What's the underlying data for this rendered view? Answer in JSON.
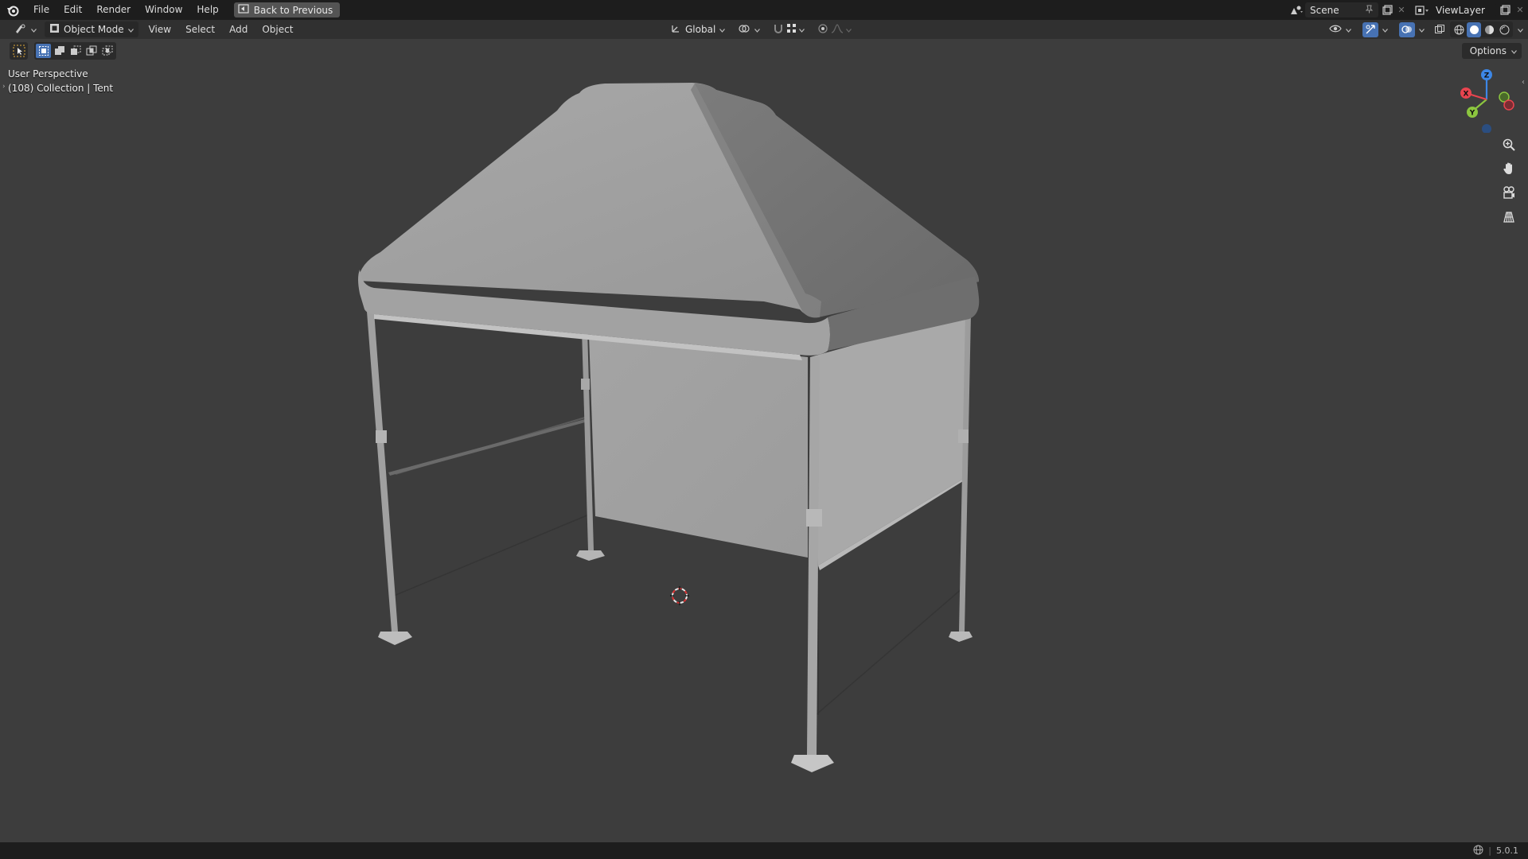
{
  "menu": {
    "file": "File",
    "edit": "Edit",
    "render": "Render",
    "window": "Window",
    "help": "Help",
    "back_to_previous": "Back to Previous"
  },
  "top_right": {
    "scene": "Scene",
    "view_layer": "ViewLayer"
  },
  "header": {
    "mode": "Object Mode",
    "view": "View",
    "select": "Select",
    "add": "Add",
    "object": "Object",
    "transform_orientation": "Global",
    "options": "Options"
  },
  "viewport": {
    "perspective_label": "User Perspective",
    "collection_label": "(108) Collection | Tent"
  },
  "gizmo": {
    "z": "Z",
    "y": "Y",
    "x": "X"
  },
  "status": {
    "version": "5.0.1"
  },
  "colors": {
    "accent_blue": "#4772b3",
    "axis_x": "#e8444f",
    "axis_y": "#8cc63f",
    "axis_z": "#3d87e6",
    "topbar": "#1d1d1d",
    "viewport_bg": "#3d3d3d"
  }
}
